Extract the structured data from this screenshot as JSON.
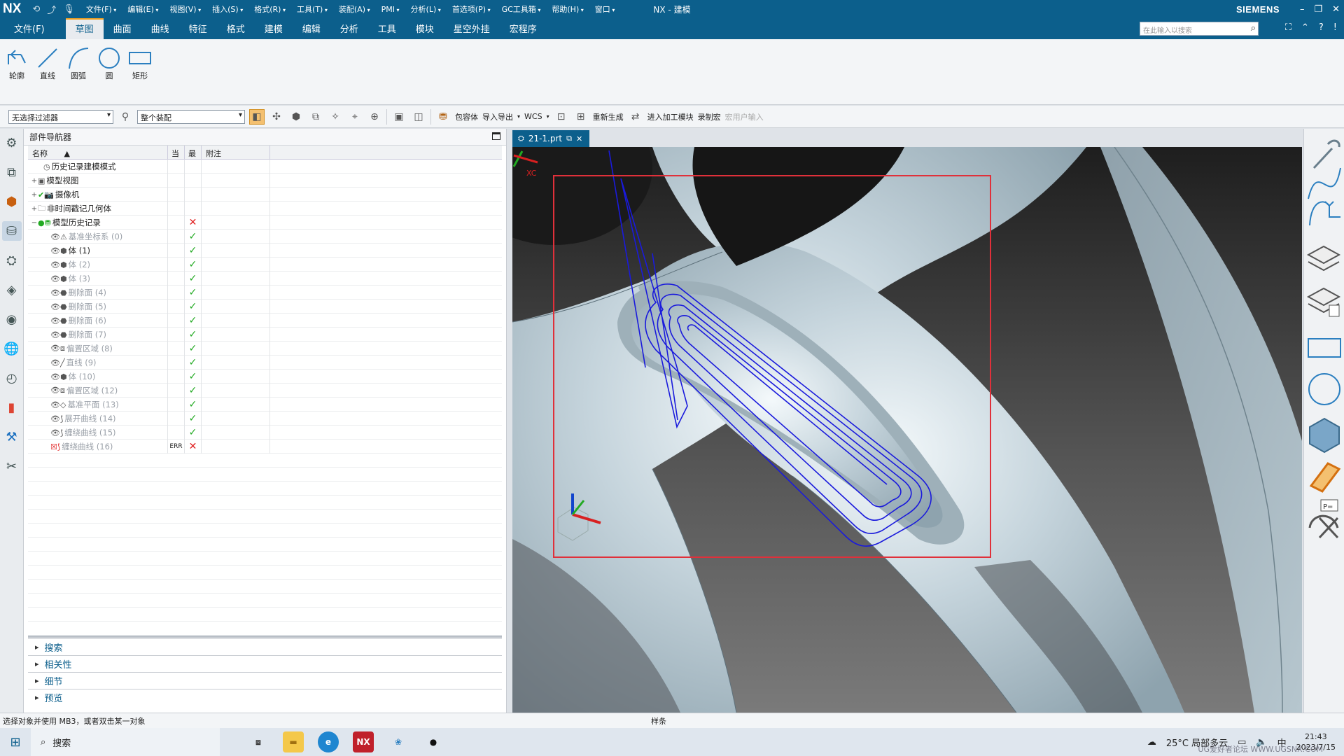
{
  "titlebar": {
    "logo": "NX",
    "menus": [
      "文件(F)",
      "编辑(E)",
      "视图(V)",
      "插入(S)",
      "格式(R)",
      "工具(T)",
      "装配(A)",
      "PMI",
      "分析(L)",
      "首选项(P)",
      "GC工具箱",
      "帮助(H)",
      "窗口"
    ],
    "title": "NX - 建模",
    "brand": "SIEMENS"
  },
  "ribbon": {
    "file_tab": "文件(F)",
    "tabs": [
      "草图",
      "曲面",
      "曲线",
      "特征",
      "格式",
      "建模",
      "编辑",
      "分析",
      "工具",
      "模块",
      "星空外挂",
      "宏程序"
    ],
    "active_tab": "草图",
    "search_placeholder": "在此输入以搜索",
    "buttons": [
      "轮廓",
      "直线",
      "圆弧",
      "圆",
      "矩形"
    ]
  },
  "toolbar": {
    "filter_combo": "无选择过滤器",
    "scope_combo": "整个装配",
    "wrap_label": "包容体",
    "import_export": "导入导出",
    "wcs": "WCS",
    "regen": "重新生成",
    "enter_machining": "进入加工模块",
    "record_macro": "录制宏",
    "user_input": "宏用户输入"
  },
  "navigator": {
    "title": "部件导航器",
    "columns": [
      "名称",
      "当",
      "最",
      "附注"
    ],
    "rows": [
      {
        "label": "历史记录建模模式",
        "icon": "clock",
        "exp": "",
        "indent": 1,
        "dim": false,
        "c2": "",
        "status": ""
      },
      {
        "label": "模型视图",
        "icon": "view",
        "exp": "+",
        "indent": 0,
        "dim": false,
        "c2": "",
        "status": ""
      },
      {
        "label": "摄像机",
        "icon": "camera",
        "exp": "+",
        "indent": 0,
        "dim": false,
        "c2": "",
        "status": ""
      },
      {
        "label": "非时间戳记几何体",
        "icon": "folder",
        "exp": "+",
        "indent": 0,
        "dim": false,
        "c2": "",
        "status": ""
      },
      {
        "label": "模型历史记录",
        "icon": "history",
        "exp": "−",
        "indent": 0,
        "dim": false,
        "c2": "",
        "status": "bad"
      },
      {
        "label": "基准坐标系 (0)",
        "icon": "csys",
        "exp": "",
        "indent": 2,
        "dim": true,
        "c2": "",
        "status": "ok"
      },
      {
        "label": "体 (1)",
        "icon": "body",
        "exp": "",
        "indent": 2,
        "dim": false,
        "c2": "",
        "status": "ok"
      },
      {
        "label": "体 (2)",
        "icon": "body",
        "exp": "",
        "indent": 2,
        "dim": true,
        "c2": "",
        "status": "ok"
      },
      {
        "label": "体 (3)",
        "icon": "body",
        "exp": "",
        "indent": 2,
        "dim": true,
        "c2": "",
        "status": "ok"
      },
      {
        "label": "删除面 (4)",
        "icon": "delface",
        "exp": "",
        "indent": 2,
        "dim": true,
        "c2": "",
        "status": "ok"
      },
      {
        "label": "删除面 (5)",
        "icon": "delface",
        "exp": "",
        "indent": 2,
        "dim": true,
        "c2": "",
        "status": "ok"
      },
      {
        "label": "删除面 (6)",
        "icon": "delface",
        "exp": "",
        "indent": 2,
        "dim": true,
        "c2": "",
        "status": "ok"
      },
      {
        "label": "删除面 (7)",
        "icon": "delface",
        "exp": "",
        "indent": 2,
        "dim": true,
        "c2": "",
        "status": "ok"
      },
      {
        "label": "偏置区域 (8)",
        "icon": "offset",
        "exp": "",
        "indent": 2,
        "dim": true,
        "c2": "",
        "status": "ok"
      },
      {
        "label": "直线 (9)",
        "icon": "line",
        "exp": "",
        "indent": 2,
        "dim": true,
        "c2": "",
        "status": "ok"
      },
      {
        "label": "体 (10)",
        "icon": "body",
        "exp": "",
        "indent": 2,
        "dim": true,
        "c2": "",
        "status": "ok"
      },
      {
        "label": "偏置区域 (12)",
        "icon": "offset",
        "exp": "",
        "indent": 2,
        "dim": true,
        "c2": "",
        "status": "ok"
      },
      {
        "label": "基准平面 (13)",
        "icon": "plane",
        "exp": "",
        "indent": 2,
        "dim": true,
        "c2": "",
        "status": "ok"
      },
      {
        "label": "展开曲线 (14)",
        "icon": "curve",
        "exp": "",
        "indent": 2,
        "dim": true,
        "c2": "",
        "status": "ok"
      },
      {
        "label": "缠绕曲线 (15)",
        "icon": "curve",
        "exp": "",
        "indent": 2,
        "dim": true,
        "c2": "",
        "status": "ok"
      },
      {
        "label": "缠绕曲线 (16)",
        "icon": "curve-err",
        "exp": "",
        "indent": 2,
        "dim": true,
        "c2": "ERR",
        "status": "bad"
      }
    ],
    "sections": [
      "搜索",
      "相关性",
      "细节",
      "预览"
    ]
  },
  "graphics": {
    "tab_label": "21-1.prt",
    "axis_label": "XC"
  },
  "status": {
    "prompt": "选择对象并使用 MB3，或者双击某一对象",
    "message": "样条"
  },
  "taskbar": {
    "search": "搜索",
    "weather": "25°C 局部多云",
    "ime": "中",
    "time": "21:43",
    "date": "2023/7/15",
    "watermark": "UG爱好者论坛 WWW.UGSNX.COM"
  },
  "colors": {
    "brand_blue": "#0c5f8c",
    "toolpath": "#1a1adc",
    "highlight_box": "#e0303a",
    "accent": "#f0a020"
  }
}
